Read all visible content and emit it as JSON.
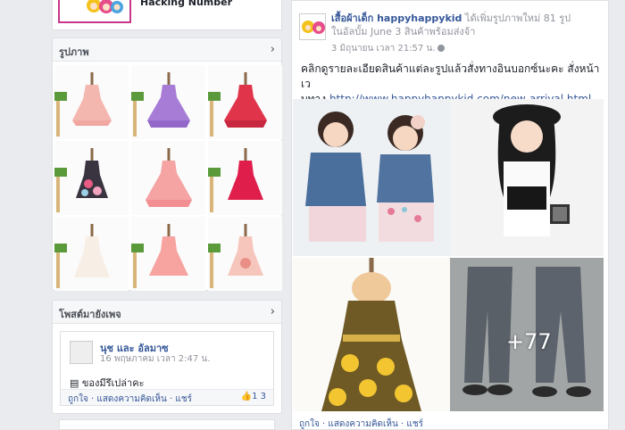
{
  "top_card": {
    "subtitle": "Hacking Number"
  },
  "photos_panel": {
    "title": "รูปภาพ",
    "chevron": "chevron-right-icon"
  },
  "posts_panel": {
    "title": "โพสต์มายังเพจ",
    "chevron": "chevron-right-icon",
    "post": {
      "author": "นุช และ อัลมาซ",
      "time": "16 พฤษภาคม เวลา 2:47 น.",
      "text": "ของมีรึเปล่าคะ",
      "actions": "ถูกใจ · แสดงความคิดเห็น · แชร์",
      "counts": "1 3"
    }
  },
  "feed_post": {
    "page_name": "เสื้อผ้าเด็ก happyhappykid",
    "header_rest": "ได้เพิ่มรูปภาพใหม่ 81 รูป",
    "header_line2": "ในอัลบั้ม June 3 สินค้าพร้อมส่งจ้า",
    "time": "3 มิถุนายน เวลา 21:57 น.",
    "caption": "คลิกดูรายละเอียดสินค้าแต่ละรูปแล้วสั่งทางอินบอกซ์นะคะ สั่งหน้าเว",
    "caption2": "บทาง ",
    "url": "http://www.happyhappykid.com/new-arrival.html",
    "more_count": "+77",
    "actions": "ถูกใจ · แสดงความคิดเห็น · แชร์"
  },
  "colors": {
    "link": "#365899",
    "pink": "#c9368c",
    "bg": "#e9ebee"
  }
}
